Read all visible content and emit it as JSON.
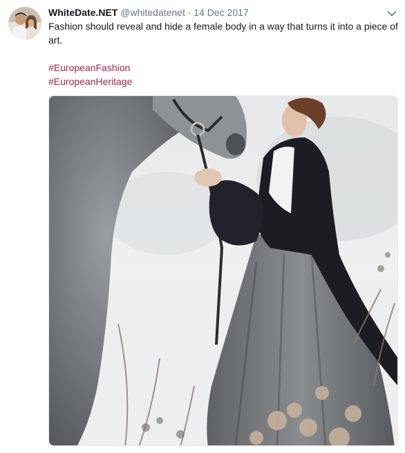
{
  "tweet": {
    "author_name": "WhiteDate.NET",
    "handle": "@whitedatenet",
    "separator": "·",
    "date": "14 Dec 2017",
    "text": "Fashion should reveal and hide a female body in a way that turns it into a piece of art.",
    "hashtags": [
      "#EuropeanFashion",
      "#EuropeanHeritage"
    ],
    "hashtag_color": "#a6234a"
  },
  "icons": {
    "menu": "chevron-down-icon"
  }
}
